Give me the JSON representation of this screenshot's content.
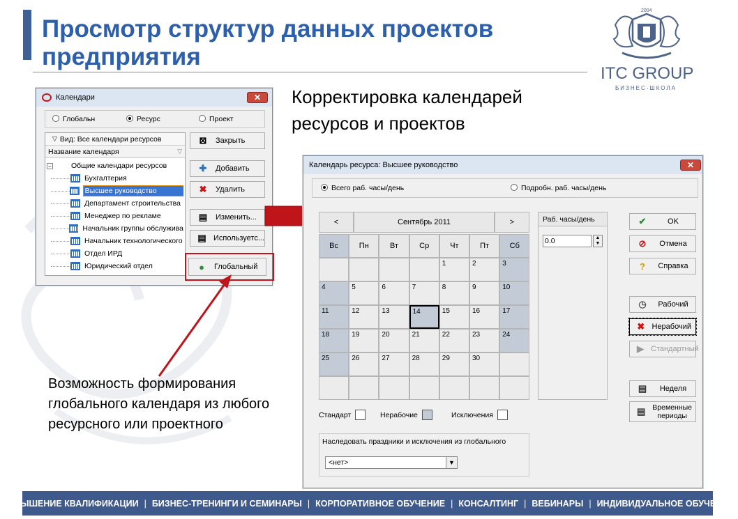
{
  "slide": {
    "title": "Просмотр структур данных проектов предприятия",
    "heading": "Корректировка календарей ресурсов и проектов",
    "note": "Возможность формирования глобального календаря из любого ресурсного или проектного",
    "logo": {
      "year": "2004",
      "name": "ITC GROUP",
      "sub": "БИЗНЕС-ШКОЛА"
    },
    "footer": [
      "ПОВЫШЕНИЕ КВАЛИФИКАЦИИ",
      "БИЗНЕС-ТРЕНИНГИ И СЕМИНАРЫ",
      "КОРПОРАТИВНОЕ ОБУЧЕНИЕ",
      "КОНСАЛТИНГ",
      "ВЕБИНАРЫ",
      "ИНДИВИДУАЛЬНОЕ ОБУЧЕНИЕ"
    ],
    "colors": {
      "title": "#2e5faa",
      "footer": "#3e5a8c",
      "accent": "#3e6195",
      "arrow": "#c0141b"
    }
  },
  "cal_win": {
    "title": "Календари",
    "radios": [
      {
        "label": "Глобальн",
        "on": false
      },
      {
        "label": "Ресурс",
        "on": true
      },
      {
        "label": "Проект",
        "on": false
      }
    ],
    "view": "Вид: Все календари ресурсов",
    "col_header": "Название календаря",
    "root": "Общие календари ресурсов",
    "items": [
      "Бухгалтерия",
      "Высшее руководство",
      "Департамент строительства",
      "Менеджер по рекламе",
      "Начальник группы обслужива",
      "Начальник технологического",
      "Отдел ИРД",
      "Юридический отдел"
    ],
    "selected": 1,
    "buttons": [
      "Закрыть",
      "Добавить",
      "Удалить",
      "Изменить...",
      "Используетс...",
      "Глобальный"
    ],
    "button_icons": [
      "close-doc-icon",
      "plus-icon",
      "x-icon",
      "edit-icon",
      "used-icon",
      "globe-icon"
    ]
  },
  "res_win": {
    "title": "Календарь ресурса: Высшее руководство",
    "radio1": "Всего раб. часы/день",
    "radio2": "Подробн. раб. часы/день",
    "prev": "<",
    "next": ">",
    "month": "Сентябрь 2011",
    "days": [
      "Вс",
      "Пн",
      "Вт",
      "Ср",
      "Чт",
      "Пт",
      "Сб"
    ],
    "grid": [
      [
        "",
        "",
        "",
        "",
        "1",
        "2",
        "3"
      ],
      [
        "4",
        "5",
        "6",
        "7",
        "8",
        "9",
        "10"
      ],
      [
        "11",
        "12",
        "13",
        "14",
        "15",
        "16",
        "17"
      ],
      [
        "18",
        "19",
        "20",
        "21",
        "22",
        "23",
        "24"
      ],
      [
        "25",
        "26",
        "27",
        "28",
        "29",
        "30",
        ""
      ],
      [
        "",
        "",
        "",
        "",
        "",
        "",
        ""
      ]
    ],
    "selected_day": "14",
    "hours_label": "Раб. часы/день",
    "hours_value": "0.0",
    "legend": [
      "Стандарт",
      "Нерабочие",
      "Исключения"
    ],
    "inherit_label": "Наследовать праздники и исключения из глобального",
    "inherit_value": "<нет>",
    "buttons": [
      "OK",
      "Отмена",
      "Справка",
      "Рабочий",
      "Нерабочий",
      "Стандартный",
      "Неделя",
      "Временные периоды"
    ]
  }
}
